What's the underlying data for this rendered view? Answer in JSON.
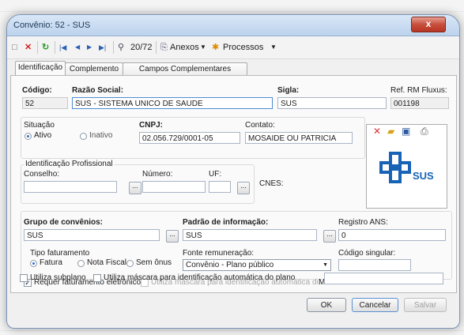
{
  "window": {
    "title": "Convênio: 52 - SUS",
    "close_label": "x"
  },
  "toolbar": {
    "nav_counter": "20/72",
    "anexos_label": "Anexos",
    "processos_label": "Processos"
  },
  "tabs": [
    "Identificação",
    "Complemento",
    "Campos Complementares"
  ],
  "form": {
    "codigo_label": "Código:",
    "codigo_value": "52",
    "razao_label": "Razão Social:",
    "razao_value": "SUS - SISTEMA UNICO DE SAUDE",
    "sigla_label": "Sigla:",
    "sigla_value": "SUS",
    "ref_label": "Ref. RM Fluxus:",
    "ref_value": "001198",
    "situacao_label": "Situação",
    "ativo_label": "Ativo",
    "inativo_label": "Inativo",
    "cnpj_label": "CNPJ:",
    "cnpj_value": "02.056.729/0001-05",
    "contato_label": "Contato:",
    "contato_value": "MOSAIDE OU PATRICIA",
    "idprof_label": "Identificação Profissional",
    "conselho_label": "Conselho:",
    "numero_label": "Número:",
    "uf_label": "UF:",
    "cnes_label": "CNES:",
    "grupo_label": "Grupo de convênios:",
    "grupo_value": "SUS",
    "padrao_label": "Padrão de informação:",
    "padrao_value": "SUS",
    "registro_label": "Registro ANS:",
    "registro_value": "0",
    "tipofat_label": "Tipo faturamento",
    "fatura_label": "Fatura",
    "notafiscal_label": "Nota Fiscal",
    "semonus_label": "Sem ônus",
    "fonte_label": "Fonte remuneração:",
    "fonte_value": "Convênio - Plano público",
    "codsingular_label": "Código singular:",
    "req_fat_label": "Requer faturamento eletrônico",
    "utiliza_mascara_sub_label": "Utiliza máscara para identificação automática do subplano",
    "mascara_label": "Máscara:",
    "utiliza_subplano_label": "Utiliza subplano",
    "utiliza_mascara_plano_label": "Utiliza máscara para identificação automática do plano"
  },
  "logo": {
    "text": "SUS",
    "color": "#1763b5"
  },
  "buttons": {
    "ok": "OK",
    "cancelar": "Cancelar",
    "salvar": "Salvar"
  }
}
